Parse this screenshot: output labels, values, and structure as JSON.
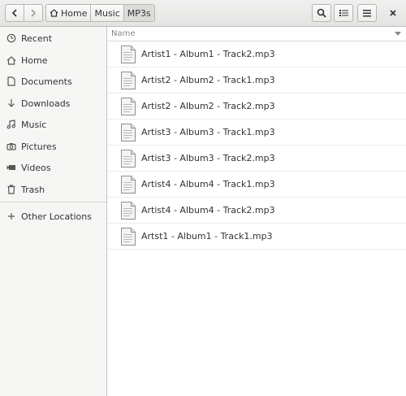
{
  "header": {
    "breadcrumbs": [
      {
        "label": "Home",
        "icon": "home-icon"
      },
      {
        "label": "Music"
      },
      {
        "label": "MP3s"
      }
    ],
    "buttons": {
      "back": "chevron-left-icon",
      "forward": "chevron-right-icon",
      "search": "search-icon",
      "view": "list-view-icon",
      "menu": "hamburger-menu-icon",
      "close": "close-icon"
    }
  },
  "sidebar": {
    "items": [
      {
        "label": "Recent",
        "icon": "clock-icon"
      },
      {
        "label": "Home",
        "icon": "home-icon"
      },
      {
        "label": "Documents",
        "icon": "document-icon"
      },
      {
        "label": "Downloads",
        "icon": "download-arrow-icon"
      },
      {
        "label": "Music",
        "icon": "music-note-icon"
      },
      {
        "label": "Pictures",
        "icon": "camera-icon"
      },
      {
        "label": "Videos",
        "icon": "video-camera-icon"
      },
      {
        "label": "Trash",
        "icon": "trash-icon"
      }
    ],
    "other": {
      "label": "Other Locations",
      "icon": "plus-icon"
    }
  },
  "list": {
    "column_name": "Name",
    "files": [
      "Artist1 - Album1 - Track2.mp3",
      "Artist2 - Album2 - Track1.mp3",
      "Artist2 - Album2 - Track2.mp3",
      "Artist3 - Album3 - Track1.mp3",
      "Artist3 - Album3 - Track2.mp3",
      "Artist4 - Album4 - Track1.mp3",
      "Artist4 - Album4 - Track2.mp3",
      "Artst1 - Album1 - Track1.mp3"
    ]
  }
}
